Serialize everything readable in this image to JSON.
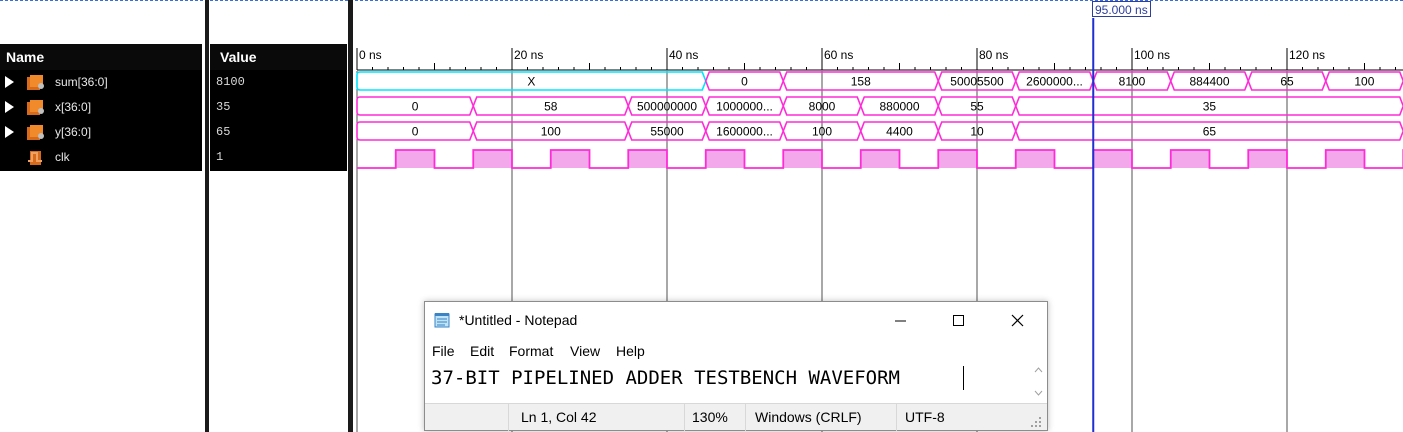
{
  "left_pane": {
    "name_header": "Name",
    "value_header": "Value"
  },
  "signals": [
    {
      "name": "sum[36:0]",
      "value": "8100",
      "icon": "bus-signal-icon",
      "expandable": true
    },
    {
      "name": "x[36:0]",
      "value": "35",
      "icon": "bus-signal-icon",
      "expandable": true
    },
    {
      "name": "y[36:0]",
      "value": "65",
      "icon": "bus-signal-icon",
      "expandable": true
    },
    {
      "name": "clk",
      "value": "1",
      "icon": "clock-signal-icon",
      "expandable": false
    }
  ],
  "timeline": {
    "unit": "ns",
    "range_ns": [
      0,
      131
    ],
    "major_ticks": [
      {
        "t": 0,
        "label": "0 ns"
      },
      {
        "t": 20,
        "label": "20 ns"
      },
      {
        "t": 40,
        "label": "40 ns"
      },
      {
        "t": 60,
        "label": "60 ns"
      },
      {
        "t": 80,
        "label": "80 ns"
      },
      {
        "t": 100,
        "label": "100 ns"
      },
      {
        "t": 120,
        "label": "120 ns"
      }
    ],
    "cursor": {
      "t": 95,
      "label": "95.000 ns"
    }
  },
  "waves": {
    "sum": [
      {
        "start": 0,
        "end": 45,
        "label": "X",
        "undefined": true
      },
      {
        "start": 45,
        "end": 55,
        "label": "0"
      },
      {
        "start": 55,
        "end": 75,
        "label": "158"
      },
      {
        "start": 75,
        "end": 85,
        "label": "50005500"
      },
      {
        "start": 85,
        "end": 95,
        "label": "2600000..."
      },
      {
        "start": 95,
        "end": 105,
        "label": "8100"
      },
      {
        "start": 105,
        "end": 115,
        "label": "884400"
      },
      {
        "start": 115,
        "end": 125,
        "label": "65"
      },
      {
        "start": 125,
        "end": 135,
        "label": "100"
      }
    ],
    "x": [
      {
        "start": 0,
        "end": 15,
        "label": "0"
      },
      {
        "start": 15,
        "end": 35,
        "label": "58"
      },
      {
        "start": 35,
        "end": 45,
        "label": "500000000"
      },
      {
        "start": 45,
        "end": 55,
        "label": "1000000..."
      },
      {
        "start": 55,
        "end": 65,
        "label": "8000"
      },
      {
        "start": 65,
        "end": 75,
        "label": "880000"
      },
      {
        "start": 75,
        "end": 85,
        "label": "55"
      },
      {
        "start": 85,
        "end": 135,
        "label": "35"
      }
    ],
    "y": [
      {
        "start": 0,
        "end": 15,
        "label": "0"
      },
      {
        "start": 15,
        "end": 35,
        "label": "100"
      },
      {
        "start": 35,
        "end": 45,
        "label": "55000"
      },
      {
        "start": 45,
        "end": 55,
        "label": "1600000..."
      },
      {
        "start": 55,
        "end": 65,
        "label": "100"
      },
      {
        "start": 65,
        "end": 75,
        "label": "4400"
      },
      {
        "start": 75,
        "end": 85,
        "label": "10"
      },
      {
        "start": 85,
        "end": 135,
        "label": "65"
      }
    ],
    "clk": {
      "period": 10,
      "high_start": 5
    }
  },
  "colors": {
    "bus": "#ff2bd8",
    "undefined_bus": "#00e5ff",
    "clk_fill": "#f2a8ea",
    "cursor": "#1f2fd0"
  },
  "notepad": {
    "title": "*Untitled - Notepad",
    "menu": [
      "File",
      "Edit",
      "Format",
      "View",
      "Help"
    ],
    "content": "37-BIT PIPELINED ADDER TESTBENCH WAVEFORM",
    "status": {
      "position": "Ln 1, Col 42",
      "zoom": "130%",
      "line_ending": "Windows (CRLF)",
      "encoding": "UTF-8"
    },
    "controls": {
      "minimize": "minimize-icon",
      "maximize": "maximize-icon",
      "close": "close-icon"
    }
  }
}
